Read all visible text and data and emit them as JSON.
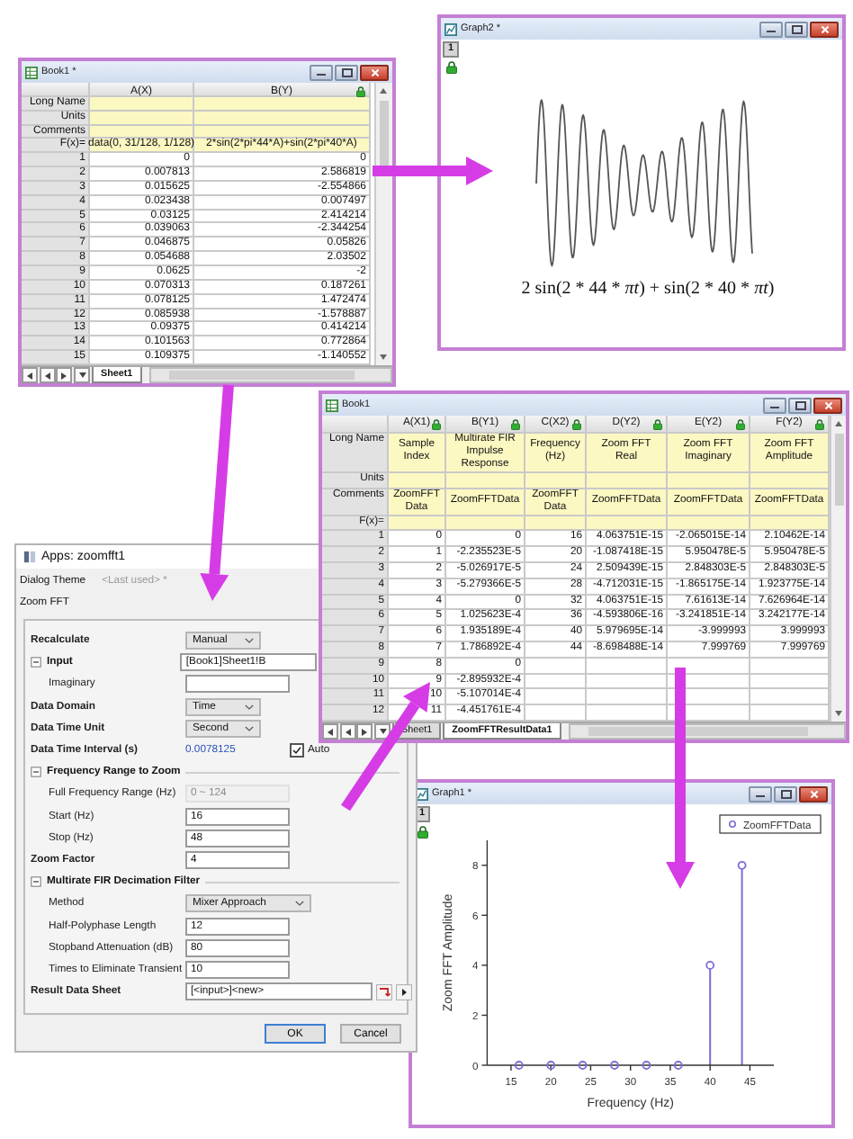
{
  "book1": {
    "title": "Book1 *",
    "columns": [
      {
        "label": "A(X)",
        "locked": false
      },
      {
        "label": "B(Y)",
        "locked": true
      }
    ],
    "header_rows": [
      {
        "label": "Long Name"
      },
      {
        "label": "Units"
      },
      {
        "label": "Comments"
      },
      {
        "label": "F(x)=",
        "cells": [
          "data(0, 31/128, 1/128)",
          "2*sin(2*pi*44*A)+sin(2*pi*40*A)"
        ]
      }
    ],
    "rows": [
      {
        "index": "1",
        "cells": [
          "0",
          "0"
        ]
      },
      {
        "index": "2",
        "cells": [
          "0.007813",
          "2.586819"
        ]
      },
      {
        "index": "3",
        "cells": [
          "0.015625",
          "-2.554866"
        ]
      },
      {
        "index": "4",
        "cells": [
          "0.023438",
          "0.007497"
        ]
      },
      {
        "index": "5",
        "cells": [
          "0.03125",
          "2.414214"
        ]
      },
      {
        "index": "6",
        "cells": [
          "0.039063",
          "-2.344254"
        ]
      },
      {
        "index": "7",
        "cells": [
          "0.046875",
          "0.05826"
        ]
      },
      {
        "index": "8",
        "cells": [
          "0.054688",
          "2.03502"
        ]
      },
      {
        "index": "9",
        "cells": [
          "0.0625",
          "-2"
        ]
      },
      {
        "index": "10",
        "cells": [
          "0.070313",
          "0.187261"
        ]
      },
      {
        "index": "11",
        "cells": [
          "0.078125",
          "1.472474"
        ]
      },
      {
        "index": "12",
        "cells": [
          "0.085938",
          "-1.578887"
        ]
      },
      {
        "index": "13",
        "cells": [
          "0.09375",
          "0.414214"
        ]
      },
      {
        "index": "14",
        "cells": [
          "0.101563",
          "0.772864"
        ]
      },
      {
        "index": "15",
        "cells": [
          "0.109375",
          "-1.140552"
        ]
      }
    ],
    "tabs": [
      {
        "label": "Sheet1",
        "selected": true
      }
    ]
  },
  "graph2": {
    "title": "Graph2 *",
    "layer": "1",
    "formula": "2 sin(2 * 44 * *πt*) + sin(2 * 40 * *πt*)"
  },
  "book2": {
    "title": "Book1",
    "columns": [
      {
        "label": "A(X1)",
        "locked": true
      },
      {
        "label": "B(Y1)",
        "locked": true
      },
      {
        "label": "C(X2)",
        "locked": true
      },
      {
        "label": "D(Y2)",
        "locked": true
      },
      {
        "label": "E(Y2)",
        "locked": true
      },
      {
        "label": "F(Y2)",
        "locked": true
      }
    ],
    "header_rows": [
      {
        "label": "Long Name",
        "cells": [
          "Sample Index",
          "Multirate FIR Impulse Response",
          "Frequency (Hz)",
          "Zoom FFT Real",
          "Zoom FFT Imaginary",
          "Zoom FFT Amplitude"
        ]
      },
      {
        "label": "Units"
      },
      {
        "label": "Comments",
        "cells": [
          "ZoomFFTData",
          "ZoomFFTData",
          "ZoomFFTData",
          "ZoomFFTData",
          "ZoomFFTData",
          "ZoomFFTData"
        ]
      },
      {
        "label": "F(x)="
      }
    ],
    "rows": [
      {
        "index": "1",
        "cells": [
          "0",
          "0",
          "16",
          "4.063751E-15",
          "-2.065015E-14",
          "2.10462E-14"
        ]
      },
      {
        "index": "2",
        "cells": [
          "1",
          "-2.235523E-5",
          "20",
          "-1.087418E-15",
          "5.950478E-5",
          "5.950478E-5"
        ]
      },
      {
        "index": "3",
        "cells": [
          "2",
          "-5.026917E-5",
          "24",
          "2.509439E-15",
          "2.848303E-5",
          "2.848303E-5"
        ]
      },
      {
        "index": "4",
        "cells": [
          "3",
          "-5.279366E-5",
          "28",
          "-4.712031E-15",
          "-1.865175E-14",
          "1.923775E-14"
        ]
      },
      {
        "index": "5",
        "cells": [
          "4",
          "0",
          "32",
          "4.063751E-15",
          "7.61613E-14",
          "7.626964E-14"
        ]
      },
      {
        "index": "6",
        "cells": [
          "5",
          "1.025623E-4",
          "36",
          "-4.593806E-16",
          "-3.241851E-14",
          "3.242177E-14"
        ]
      },
      {
        "index": "7",
        "cells": [
          "6",
          "1.935189E-4",
          "40",
          "5.979695E-14",
          "-3.999993",
          "3.999993"
        ]
      },
      {
        "index": "8",
        "cells": [
          "7",
          "1.786892E-4",
          "44",
          "-8.698488E-14",
          "7.999769",
          "7.999769"
        ]
      },
      {
        "index": "9",
        "cells": [
          "8",
          "0"
        ]
      },
      {
        "index": "10",
        "cells": [
          "9",
          "-2.895932E-4"
        ]
      },
      {
        "index": "11",
        "cells": [
          "10",
          "-5.107014E-4"
        ]
      },
      {
        "index": "12",
        "cells": [
          "11",
          "-4.451761E-4"
        ]
      }
    ],
    "tabs": [
      {
        "label": "Sheet1",
        "selected": false
      },
      {
        "label": "ZoomFFTResultData1",
        "selected": true
      }
    ]
  },
  "dialog": {
    "title": "Apps: zoomfft1",
    "theme": {
      "label": "Dialog Theme",
      "value": "<Last used> *"
    },
    "heading": "Zoom FFT",
    "rows": [
      {
        "kind": "dropdown",
        "label": "Recalculate",
        "value": "Manual"
      },
      {
        "kind": "section",
        "label": "Input",
        "expanded": true,
        "value": "[Book1]Sheet1!B",
        "children": [
          {
            "kind": "field",
            "label": "Imaginary",
            "disabled": false
          }
        ]
      },
      {
        "kind": "dropdown",
        "label": "Data Domain",
        "value": "Time"
      },
      {
        "kind": "dropdown",
        "label": "Data Time Unit",
        "value": "Second"
      },
      {
        "kind": "interval",
        "label": "Data Time Interval (s)",
        "value": "0.0078125",
        "check_label": "Auto",
        "checked": true
      },
      {
        "kind": "section",
        "label": "Frequency Range to Zoom",
        "expanded": true,
        "children": [
          {
            "kind": "field",
            "label": "Full Frequency Range (Hz)",
            "value": "0 ~ 124",
            "disabled": true
          },
          {
            "kind": "field",
            "label": "Start (Hz)",
            "value": "16",
            "disabled": false
          },
          {
            "kind": "field",
            "label": "Stop (Hz)",
            "value": "48",
            "disabled": false
          }
        ]
      },
      {
        "kind": "field",
        "label": "Zoom Factor",
        "value": "4",
        "disabled": false
      },
      {
        "kind": "section",
        "label": "Multirate FIR Decimation Filter",
        "expanded": true,
        "children": [
          {
            "kind": "dropdown",
            "label": "Method",
            "value": "Mixer Approach"
          },
          {
            "kind": "field",
            "label": "Half-Polyphase Length",
            "value": "12",
            "disabled": false
          },
          {
            "kind": "field",
            "label": "Stopband Attenuation (dB)",
            "value": "80",
            "disabled": false
          },
          {
            "kind": "field",
            "label": "Times to Eliminate Transient",
            "value": "10",
            "disabled": false
          }
        ]
      },
      {
        "kind": "output",
        "label": "Result Data Sheet",
        "value": "[<input>]<new>"
      }
    ],
    "buttons": [
      {
        "label": "OK",
        "default": true
      },
      {
        "label": "Cancel",
        "default": false
      }
    ]
  },
  "graph1": {
    "title": "Graph1 *",
    "layer": "1",
    "chart_data": {
      "type": "scatter",
      "xlabel": "Frequency (Hz)",
      "ylabel": "Zoom FFT Amplitude",
      "x": [
        16,
        20,
        24,
        28,
        32,
        36,
        40,
        44
      ],
      "series": [
        {
          "name": "ZoomFFTData",
          "color": "#7a6cd8",
          "values": [
            0,
            0,
            0,
            0,
            0,
            0,
            4,
            8
          ]
        }
      ],
      "xlim": [
        12,
        48
      ],
      "ylim": [
        0,
        9
      ],
      "xticks": [
        15,
        20,
        25,
        30,
        35,
        40,
        45
      ],
      "yticks": [
        0,
        2,
        4,
        6,
        8
      ]
    }
  }
}
